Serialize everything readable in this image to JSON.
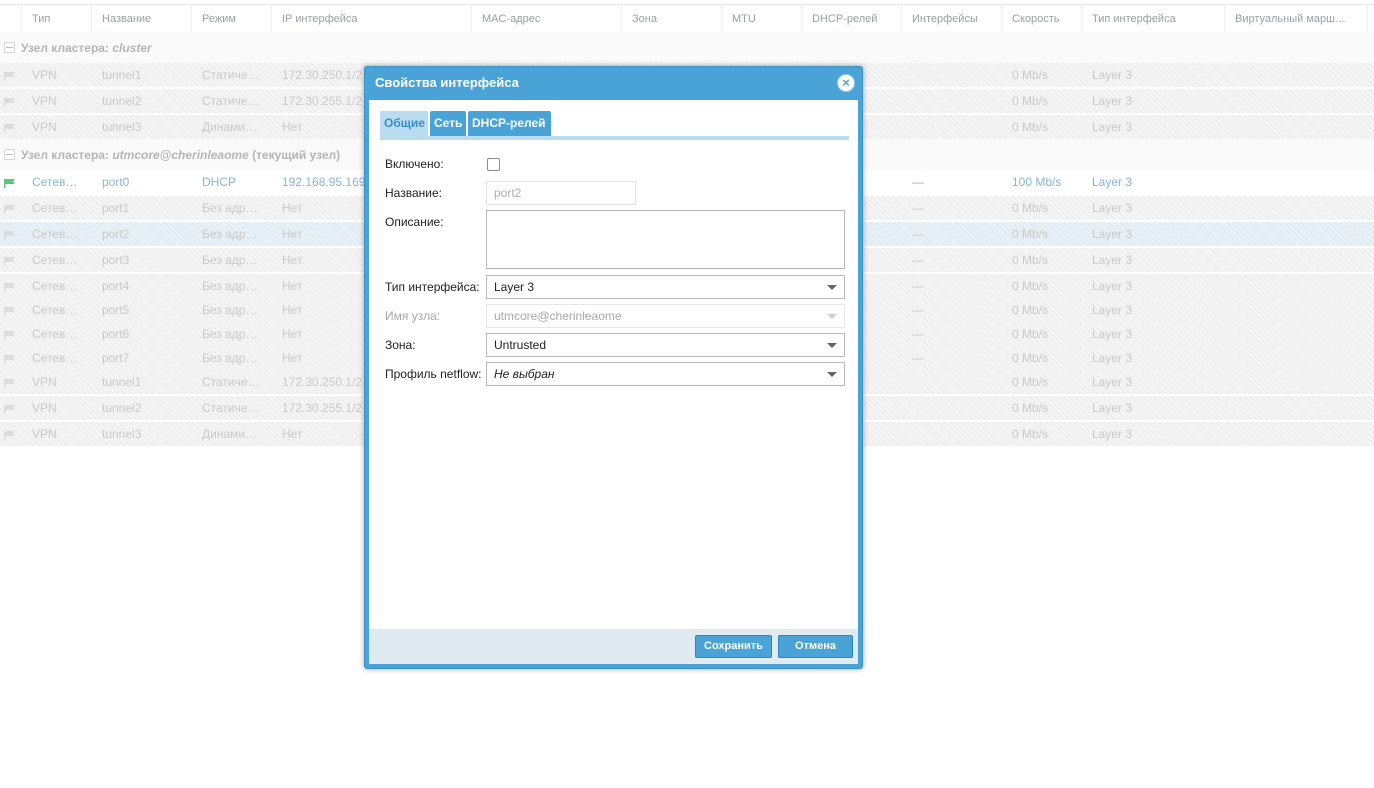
{
  "grid": {
    "columns": [
      "Тип",
      "Название",
      "Режим",
      "IP интерфейса",
      "MAC-адрес",
      "Зона",
      "MTU",
      "DHCP-релей",
      "Интерфейсы",
      "Скорость",
      "Тип интерфейса",
      "Виртуальный марш…"
    ],
    "groups": [
      {
        "prefix": "Узел кластера:",
        "name": "cluster",
        "suffix": ""
      },
      {
        "prefix": "Узел кластера:",
        "name": "utmcore@cherinleaome",
        "suffix": "(текущий узел)"
      }
    ],
    "rows": [
      {
        "type": "VPN",
        "name": "tunnel1",
        "mode": "Статиче…",
        "ip": "172.30.250.1/2",
        "ifaces": "",
        "speed": "0 Mb/s",
        "iftype": "Layer 3"
      },
      {
        "type": "VPN",
        "name": "tunnel2",
        "mode": "Статиче…",
        "ip": "172.30.255.1/2",
        "ifaces": "",
        "speed": "0 Mb/s",
        "iftype": "Layer 3"
      },
      {
        "type": "VPN",
        "name": "tunnel3",
        "mode": "Динами…",
        "ip": "Нет",
        "ifaces": "",
        "speed": "0 Mb/s",
        "iftype": "Layer 3"
      },
      {
        "type": "Сетев…",
        "name": "port0",
        "mode": "DHCP",
        "ip": "192.168.95.169",
        "ifaces": "—",
        "speed": "100 Mb/s",
        "iftype": "Layer 3"
      },
      {
        "type": "Сетев…",
        "name": "port1",
        "mode": "Без адр…",
        "ip": "Нет",
        "ifaces": "—",
        "speed": "0 Mb/s",
        "iftype": "Layer 3"
      },
      {
        "type": "Сетев…",
        "name": "port2",
        "mode": "Без адр…",
        "ip": "Нет",
        "ifaces": "—",
        "speed": "0 Mb/s",
        "iftype": "Layer 3"
      },
      {
        "type": "Сетев…",
        "name": "port3",
        "mode": "Без адр…",
        "ip": "Нет",
        "ifaces": "—",
        "speed": "0 Mb/s",
        "iftype": "Layer 3"
      },
      {
        "type": "Сетев…",
        "name": "port4",
        "mode": "Без адр…",
        "ip": "Нет",
        "ifaces": "—",
        "speed": "0 Mb/s",
        "iftype": "Layer 3"
      },
      {
        "type": "Сетев…",
        "name": "port5",
        "mode": "Без адр…",
        "ip": "Нет",
        "ifaces": "—",
        "speed": "0 Mb/s",
        "iftype": "Layer 3"
      },
      {
        "type": "Сетев…",
        "name": "port6",
        "mode": "Без адр…",
        "ip": "Нет",
        "ifaces": "—",
        "speed": "0 Mb/s",
        "iftype": "Layer 3"
      },
      {
        "type": "Сетев…",
        "name": "port7",
        "mode": "Без адр…",
        "ip": "Нет",
        "ifaces": "—",
        "speed": "0 Mb/s",
        "iftype": "Layer 3"
      },
      {
        "type": "VPN",
        "name": "tunnel1",
        "mode": "Статиче…",
        "ip": "172.30.250.1/2",
        "ifaces": "",
        "speed": "0 Mb/s",
        "iftype": "Layer 3"
      },
      {
        "type": "VPN",
        "name": "tunnel2",
        "mode": "Статиче…",
        "ip": "172.30.255.1/2",
        "ifaces": "",
        "speed": "0 Mb/s",
        "iftype": "Layer 3"
      },
      {
        "type": "VPN",
        "name": "tunnel3",
        "mode": "Динами…",
        "ip": "Нет",
        "ifaces": "",
        "speed": "0 Mb/s",
        "iftype": "Layer 3"
      }
    ]
  },
  "dialog": {
    "title": "Свойства интерфейса",
    "close_glyph": "×",
    "tabs": [
      "Общие",
      "Сеть",
      "DHCP-релей"
    ],
    "fields": {
      "enabled_label": "Включено:",
      "enabled_checked": false,
      "name_label": "Название:",
      "name_value": "port2",
      "description_label": "Описание:",
      "description_value": "",
      "iftype_label": "Тип интерфейса:",
      "iftype_value": "Layer 3",
      "node_label": "Имя узла:",
      "node_value": "utmcore@cherinleaome",
      "zone_label": "Зона:",
      "zone_value": "Untrusted",
      "netflow_label": "Профиль netflow:",
      "netflow_value": "Не выбран"
    },
    "buttons": {
      "save": "Сохранить",
      "cancel": "Отмена"
    }
  },
  "colors": {
    "accent": "#4aa3d6",
    "tab_active": "#b9dcf1",
    "footer": "#dfeaf1",
    "port0_icon": "#5cc77a"
  }
}
